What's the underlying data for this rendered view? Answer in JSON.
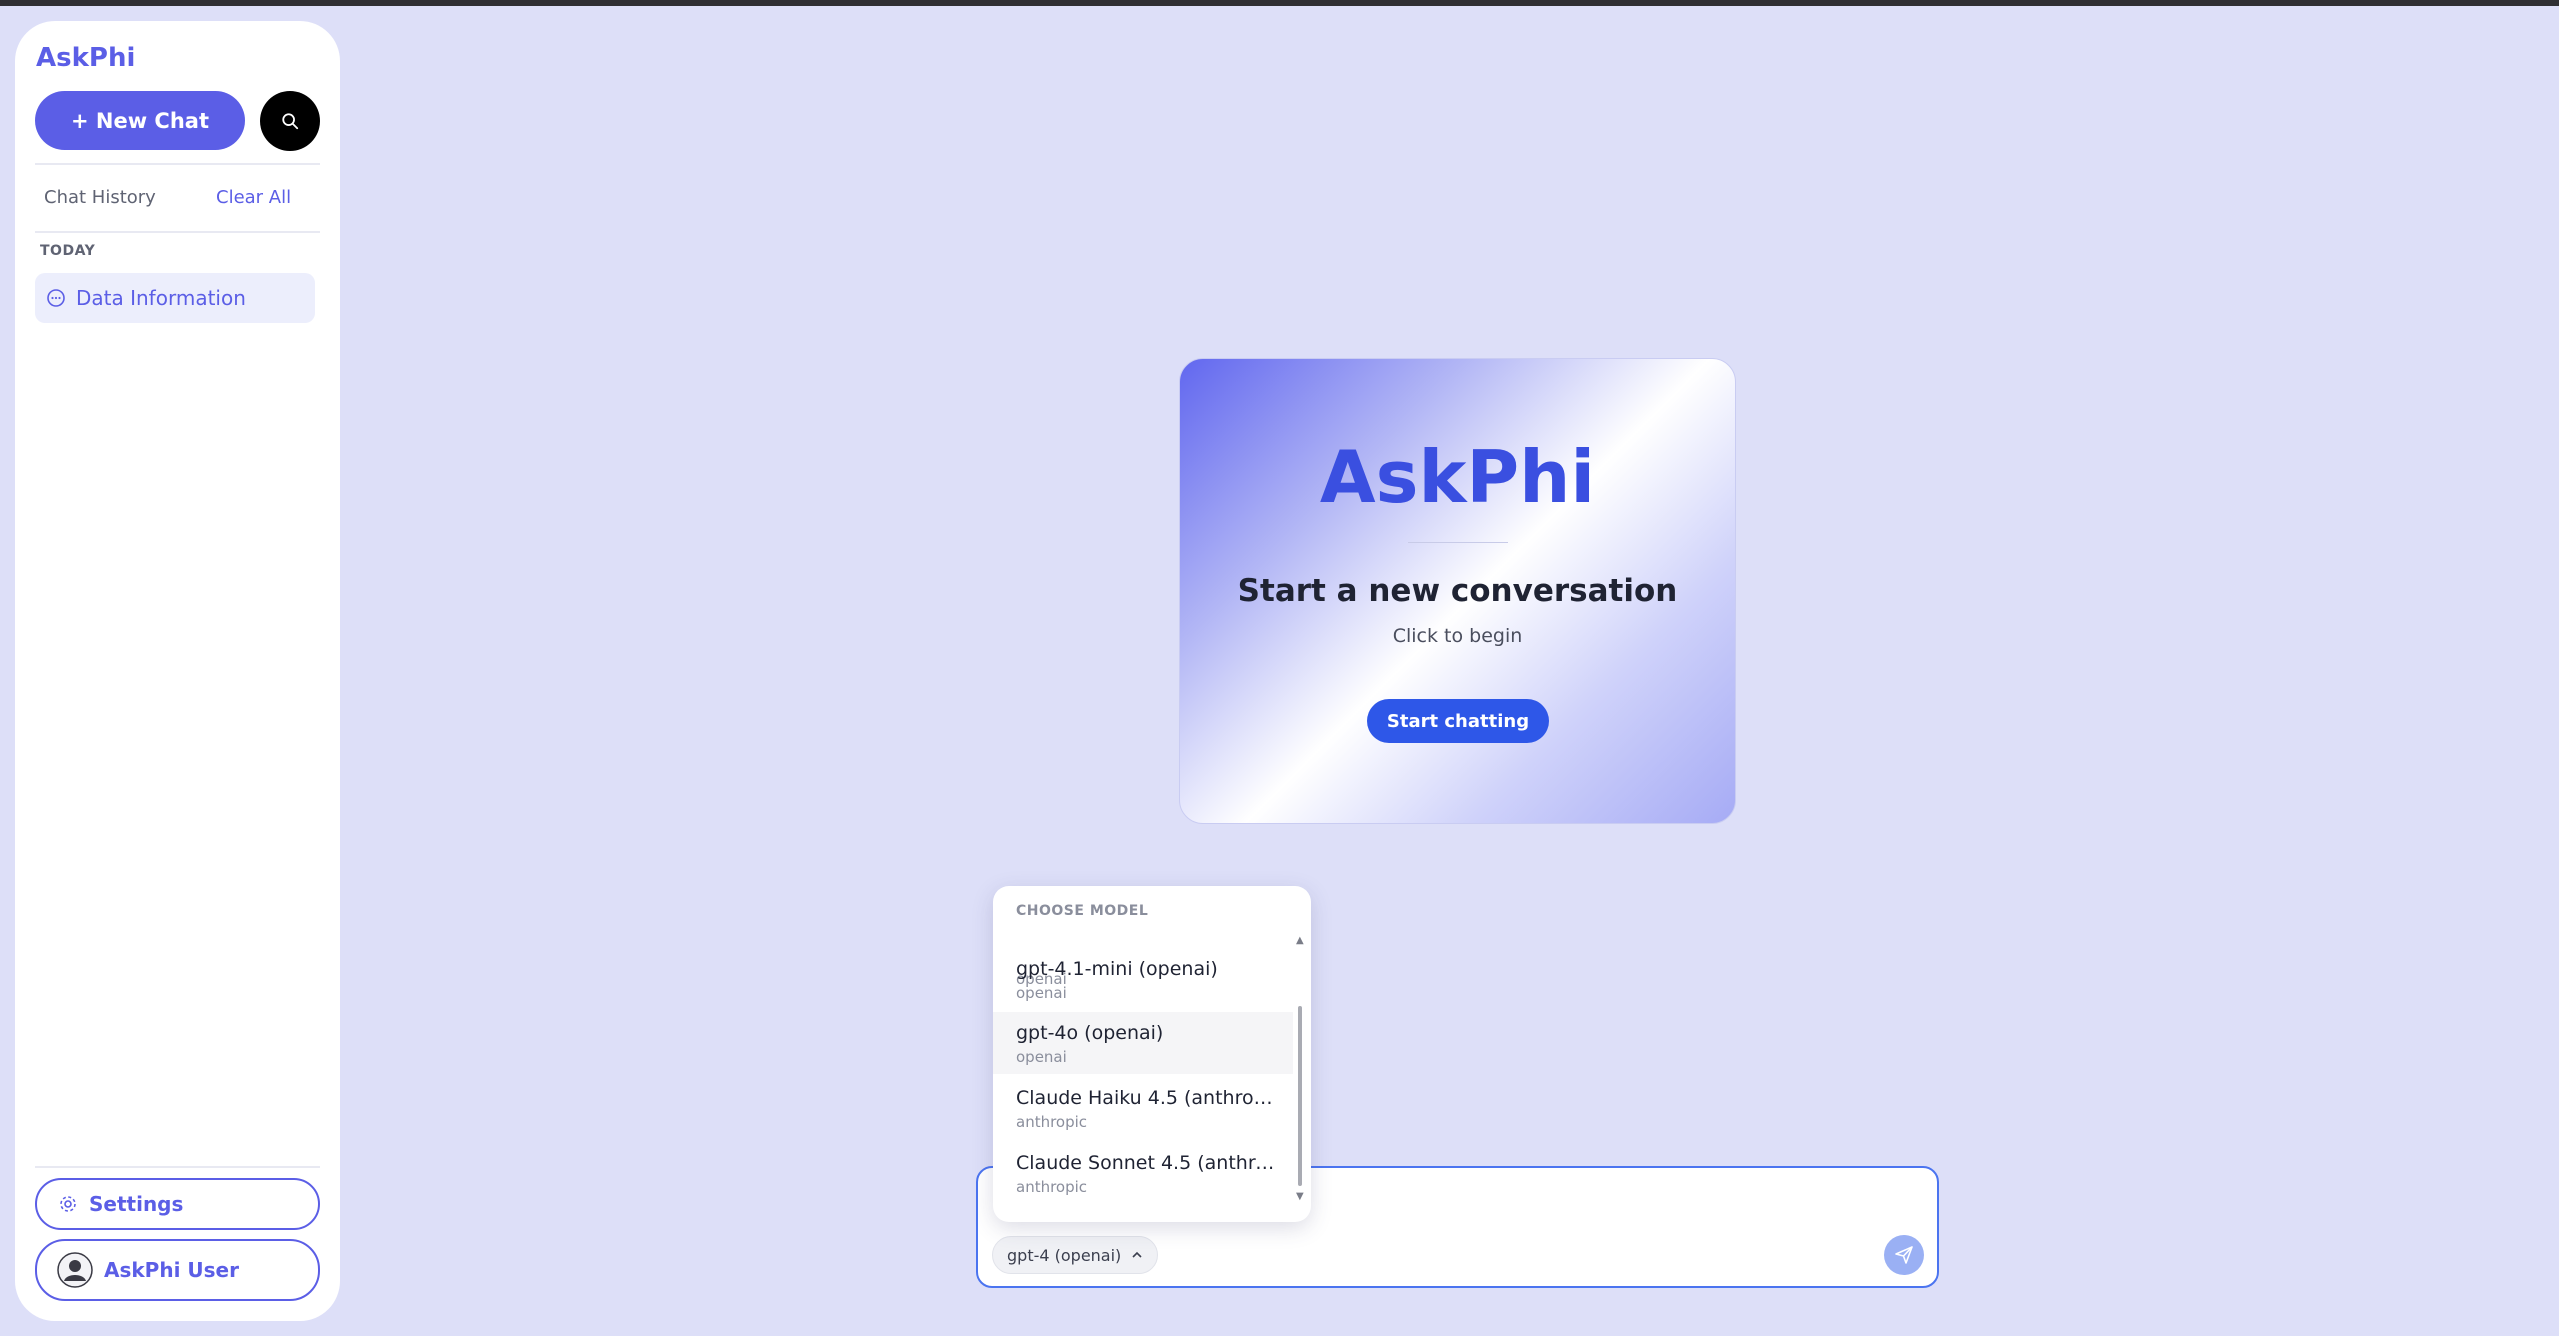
{
  "sidebar": {
    "brand": "AskPhi",
    "new_chat_label": "+ New Chat",
    "history_label": "Chat History",
    "clear_all_label": "Clear All",
    "group_label": "TODAY",
    "items": [
      {
        "label": "Data Information",
        "icon": "chat-bubble-icon"
      }
    ],
    "settings_label": "Settings",
    "user_label": "AskPhi User"
  },
  "welcome": {
    "title": "AskPhi",
    "heading": "Start a new conversation",
    "subheading": "Click to begin",
    "button_label": "Start chatting"
  },
  "composer": {
    "selected_model": "gpt-4 (openai)",
    "send_icon": "send-icon"
  },
  "model_menu": {
    "header": "CHOOSE MODEL",
    "partial_provider": "openai",
    "options": [
      {
        "name": "gpt-4.1-mini (openai)",
        "provider": "openai"
      },
      {
        "name": "gpt-4o (openai)",
        "provider": "openai"
      },
      {
        "name": "Claude Haiku 4.5 (anthropic)",
        "provider": "anthropic"
      },
      {
        "name": "Claude Sonnet 4.5 (anthrop…",
        "provider": "anthropic"
      }
    ]
  },
  "colors": {
    "accent": "#5b5ee6",
    "page_background": "#dddff8",
    "start_button": "#2e57e8",
    "composer_border": "#4b74f0"
  }
}
